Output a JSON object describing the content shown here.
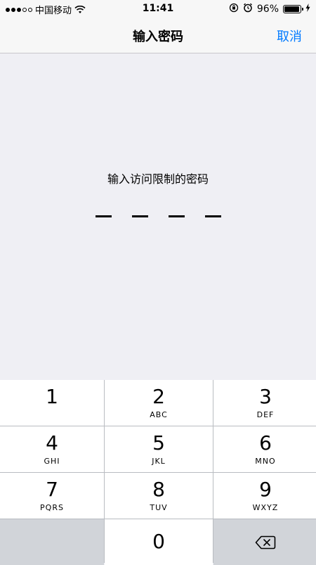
{
  "status_bar": {
    "carrier": "中国移动",
    "signal_bars_filled": 3,
    "signal_bars_total": 5,
    "time": "11:41",
    "battery_percent": "96%",
    "battery_level": 0.96,
    "icons": [
      "wifi-icon",
      "rotation-lock-icon",
      "alarm-icon",
      "battery-icon",
      "charging-bolt-icon"
    ]
  },
  "nav": {
    "title": "输入密码",
    "cancel_label": "取消",
    "accent_color": "#007aff"
  },
  "passcode": {
    "prompt": "输入访问限制的密码",
    "digit_count": 4
  },
  "keypad": {
    "keys": [
      {
        "num": "1",
        "letters": ""
      },
      {
        "num": "2",
        "letters": "ABC"
      },
      {
        "num": "3",
        "letters": "DEF"
      },
      {
        "num": "4",
        "letters": "GHI"
      },
      {
        "num": "5",
        "letters": "JKL"
      },
      {
        "num": "6",
        "letters": "MNO"
      },
      {
        "num": "7",
        "letters": "PQRS"
      },
      {
        "num": "8",
        "letters": "TUV"
      },
      {
        "num": "9",
        "letters": "WXYZ"
      }
    ],
    "zero": "0",
    "delete_icon": "backspace-icon"
  }
}
